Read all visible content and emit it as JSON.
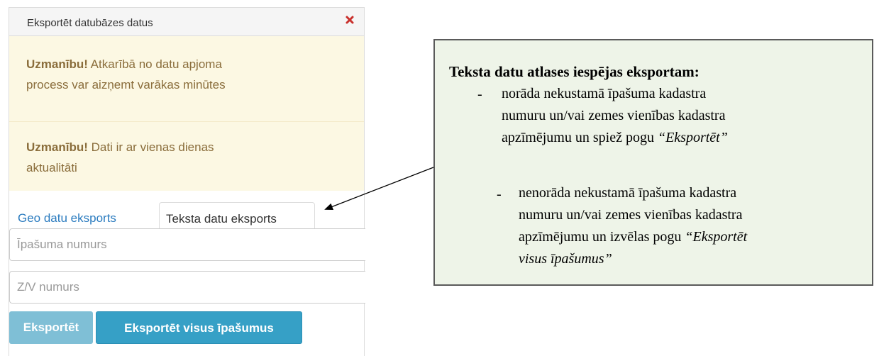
{
  "panel": {
    "title": "Eksportēt datubāzes datus",
    "alerts": [
      {
        "strong": "Uzmanību!",
        "line1_rest": " Atkarībā no datu apjoma",
        "line2": "process var aizņemt varākas minūtes"
      },
      {
        "strong": "Uzmanību!",
        "line1_rest": " Dati ir ar vienas dienas",
        "line2": "aktualitāti"
      }
    ],
    "tabs": [
      {
        "label": "Geo datu eksports",
        "active": false
      },
      {
        "label": "Teksta datu eksports",
        "active": true
      }
    ],
    "fields": [
      {
        "placeholder": "Īpašuma numurs"
      },
      {
        "placeholder": "Z/V numurs"
      }
    ],
    "buttons": {
      "export": "Eksportēt",
      "export_all": "Eksportēt visus īpašumus"
    },
    "colors": {
      "alert_bg": "#fcf8e3",
      "alert_text": "#8a6d3b",
      "link": "#2a7bbf",
      "button_primary": "#36a0c6",
      "button_disabled": "#7fbfd6",
      "close": "#c9302c"
    },
    "close_icon": "close-icon"
  },
  "callout": {
    "title": "Teksta datu atlases iespējas eksportam:",
    "items": [
      {
        "dash": "-",
        "lines": [
          "norāda nekustamā īpašuma kadastra",
          "numuru un/vai zemes vienības kadastra"
        ],
        "line3_plain": "apzīmējumu un spiež pogu ",
        "line3_italic": "“Eksportēt”"
      },
      {
        "dash": "-",
        "lines": [
          "nenorāda nekustamā īpašuma kadastra",
          "numuru un/vai zemes vienības kadastra"
        ],
        "line3_plain": "apzīmējumu un izvēlas pogu ",
        "line3_italic": "“Eksportēt",
        "line4_italic": "visus īpašumus”"
      }
    ],
    "background": "#eef4e8"
  }
}
